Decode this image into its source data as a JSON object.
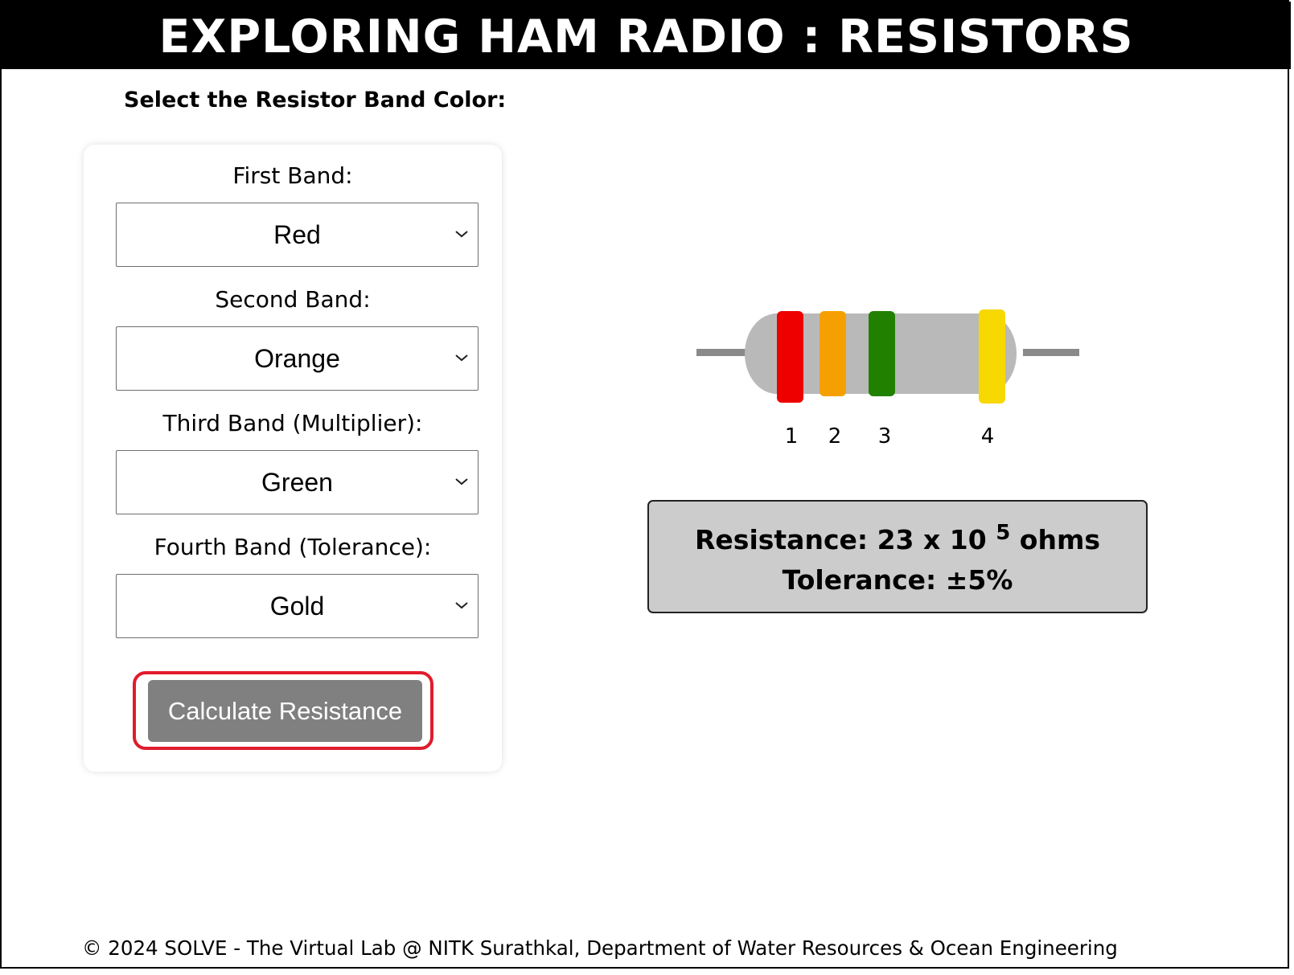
{
  "header": {
    "title": "EXPLORING HAM RADIO : RESISTORS"
  },
  "selector": {
    "heading": "Select the Resistor Band Color:",
    "bands": [
      {
        "label": "First Band:",
        "value": "Red",
        "color": "#ee0000"
      },
      {
        "label": "Second Band:",
        "value": "Orange",
        "color": "#f5a000"
      },
      {
        "label": "Third Band (Multiplier):",
        "value": "Green",
        "color": "#228000"
      },
      {
        "label": "Fourth Band (Tolerance):",
        "value": "Gold",
        "color": "#f7d800"
      }
    ],
    "calculate_label": "Calculate Resistance",
    "highlight_color": "#e01c2c"
  },
  "resistor": {
    "body_color": "#b9b9b9",
    "lead_color": "#8a8a8a",
    "band_numbers": [
      "1",
      "2",
      "3",
      "4"
    ]
  },
  "result": {
    "resistance_prefix": "Resistance: 23 x 10",
    "resistance_exponent": "5",
    "resistance_unit": "ohms",
    "tolerance": "Tolerance: ±5%"
  },
  "footer": {
    "text": "© 2024 SOLVE - The Virtual Lab @ NITK Surathkal, Department of Water Resources & Ocean Engineering"
  }
}
